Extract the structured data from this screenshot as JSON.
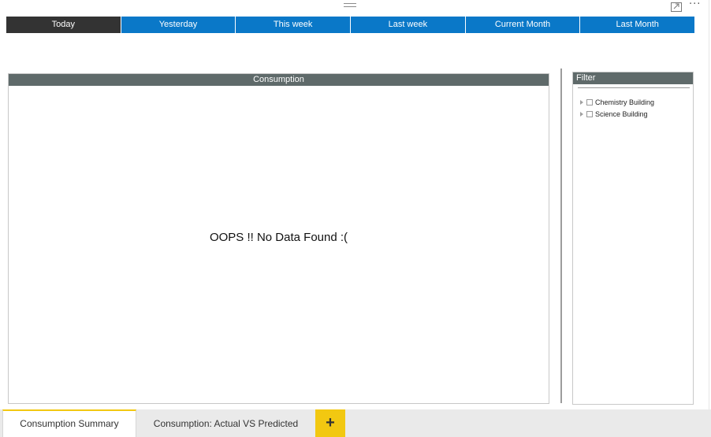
{
  "header": {
    "drag_icon": "drag-handle-icon",
    "focus_icon": "focus-mode-icon",
    "more_icon": "more-options-icon",
    "more_glyph": "···"
  },
  "date_tabs": [
    {
      "label": "Today",
      "active": true
    },
    {
      "label": "Yesterday",
      "active": false
    },
    {
      "label": "This week",
      "active": false
    },
    {
      "label": "Last week",
      "active": false
    },
    {
      "label": "Current Month",
      "active": false
    },
    {
      "label": "Last Month",
      "active": false
    }
  ],
  "consumption": {
    "title": "Consumption",
    "message": "OOPS !! No Data Found :("
  },
  "filter": {
    "title": "Filter",
    "items": [
      {
        "label": "Chemistry Building",
        "checked": false
      },
      {
        "label": "Science Building",
        "checked": false
      }
    ]
  },
  "page_tabs": [
    {
      "label": "Consumption Summary",
      "active": true
    },
    {
      "label": "Consumption: Actual VS Predicted",
      "active": false
    }
  ],
  "add_page_label": "+",
  "colors": {
    "tab_blue": "#0a78c8",
    "tab_active": "#333333",
    "panel_header": "#5f6a6a",
    "accent_yellow": "#f2c811"
  }
}
